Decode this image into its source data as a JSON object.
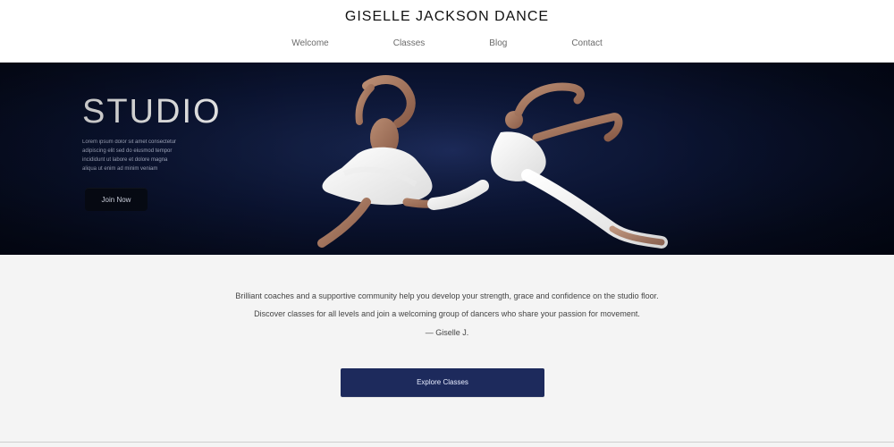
{
  "header": {
    "logo": "GISELLE JACKSON DANCE",
    "nav": [
      "Welcome",
      "Classes",
      "Blog",
      "Contact"
    ]
  },
  "hero": {
    "title": "STUDIO",
    "description_lines": [
      "Lorem ipsum dolor sit amet consectetur",
      "adipiscing elit sed do eiusmod tempor",
      "incididunt ut labore et dolore magna",
      "aliqua ut enim ad minim veniam"
    ],
    "button_label": "Join Now"
  },
  "content": {
    "paragraph_lines": [
      "Brilliant coaches and a supportive community help you develop your strength, grace and confidence on the studio floor.",
      "Discover classes for all levels and join a welcoming group of dancers who share your passion for movement."
    ],
    "signature": "— Giselle J."
  },
  "cta": {
    "label": "Explore Classes"
  },
  "colors": {
    "hero_bg": "#0b1432",
    "cta_bg": "#1d2a5c",
    "page_bg": "#f4f4f4"
  }
}
